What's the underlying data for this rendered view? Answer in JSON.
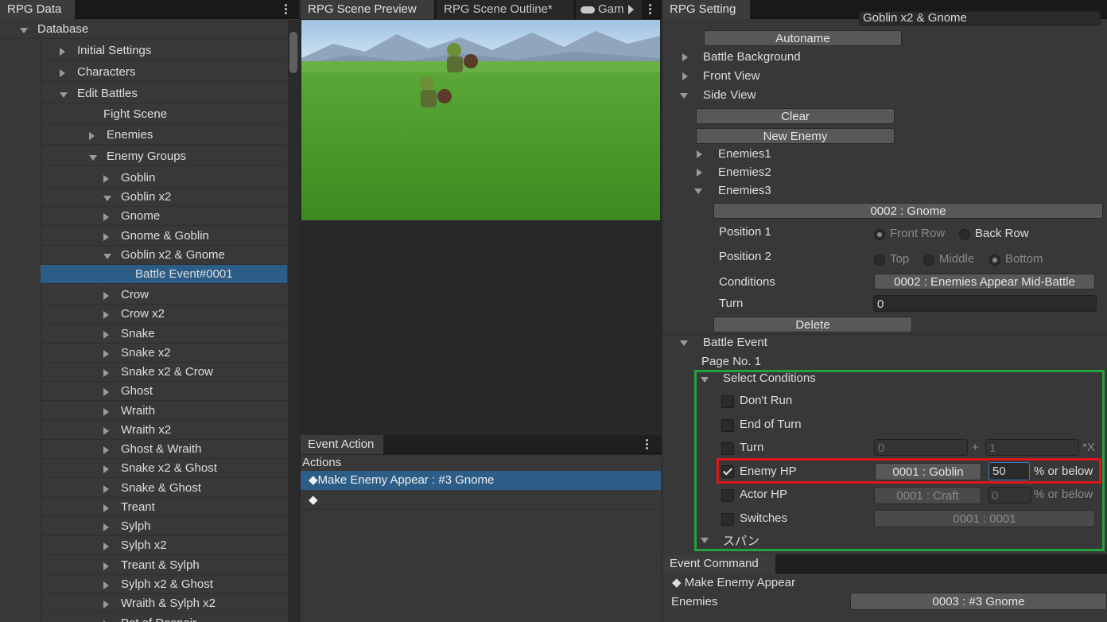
{
  "left_panel": {
    "tab": "RPG Data",
    "tree": [
      {
        "label": "Database",
        "expanded": true
      },
      {
        "label": "Initial Settings",
        "expanded": false
      },
      {
        "label": "Characters",
        "expanded": false
      },
      {
        "label": "Edit Battles",
        "expanded": true
      },
      {
        "label": "Fight Scene"
      },
      {
        "label": "Enemies",
        "expanded": false
      },
      {
        "label": "Enemy Groups",
        "expanded": true
      },
      {
        "label": "Goblin",
        "expanded": false
      },
      {
        "label": "Goblin x2",
        "expanded": true
      },
      {
        "label": "Gnome",
        "expanded": false
      },
      {
        "label": "Gnome & Goblin",
        "expanded": false
      },
      {
        "label": "Goblin x2 & Gnome",
        "expanded": true
      },
      {
        "label": "Battle Event#0001",
        "selected": true
      },
      {
        "label": "Crow",
        "expanded": false
      },
      {
        "label": "Crow x2",
        "expanded": false
      },
      {
        "label": "Snake",
        "expanded": false
      },
      {
        "label": "Snake x2",
        "expanded": false
      },
      {
        "label": "Snake x2 & Crow",
        "expanded": false
      },
      {
        "label": "Ghost",
        "expanded": false
      },
      {
        "label": "Wraith",
        "expanded": false
      },
      {
        "label": "Wraith x2",
        "expanded": false
      },
      {
        "label": "Ghost & Wraith",
        "expanded": false
      },
      {
        "label": "Snake x2 & Ghost",
        "expanded": false
      },
      {
        "label": "Snake & Ghost",
        "expanded": false
      },
      {
        "label": "Treant",
        "expanded": false
      },
      {
        "label": "Sylph",
        "expanded": false
      },
      {
        "label": "Sylph x2",
        "expanded": false
      },
      {
        "label": "Treant & Sylph",
        "expanded": false
      },
      {
        "label": "Sylph x2 & Ghost",
        "expanded": false
      },
      {
        "label": "Wraith & Sylph x2",
        "expanded": false
      },
      {
        "label": "Pot of Despair",
        "expanded": false
      }
    ]
  },
  "center_panel": {
    "tabs": [
      "RPG Scene Preview",
      "RPG Scene Outline*",
      "Gam"
    ],
    "event_action": {
      "tab": "Event Action",
      "actions_label": "Actions",
      "items": [
        "◆Make Enemy Appear : #3 Gnome",
        "◆"
      ]
    }
  },
  "right_panel": {
    "tab": "RPG Setting",
    "name_value": "Goblin x2 & Gnome",
    "autoname": "Autoname",
    "battle_background": "Battle Background",
    "front_view": "Front View",
    "side_view": "Side View",
    "clear": "Clear",
    "new_enemy": "New Enemy",
    "enemies1": "Enemies1",
    "enemies2": "Enemies2",
    "enemies3": "Enemies3",
    "enemy3_value": "0002 : Gnome",
    "position1_label": "Position 1",
    "front_row": "Front Row",
    "back_row": "Back Row",
    "position2_label": "Position 2",
    "top": "Top",
    "middle": "Middle",
    "bottom": "Bottom",
    "conditions_label": "Conditions",
    "conditions_value": "0002 : Enemies Appear Mid-Battle",
    "turn_label": "Turn",
    "turn_value": "0",
    "delete": "Delete",
    "battle_event": "Battle Event",
    "page_no": "Page No. 1",
    "select_conditions": "Select Conditions",
    "dont_run": "Don't Run",
    "end_of_turn": "End of Turn",
    "turn_cond": "Turn",
    "turn_a": "0",
    "plus": "+",
    "turn_b": "1",
    "times_x": "*X",
    "enemy_hp": "Enemy HP",
    "enemy_hp_target": "0001 : Goblin",
    "enemy_hp_value": "50",
    "pct_below": "% or below",
    "actor_hp": "Actor HP",
    "actor_hp_target": "0001 : Craft",
    "actor_hp_value": "0",
    "pct_below2": "% or below",
    "switches": "Switches",
    "switches_value": "0001 : 0001",
    "span": "スパン",
    "event_command": {
      "tab": "Event Command",
      "title": "◆ Make Enemy Appear",
      "enemies_label": "Enemies",
      "enemies_value": "0003 : #3 Gnome"
    }
  },
  "colors": {
    "selection": "#2c5d87",
    "highlight_green": "#22a33a",
    "highlight_red": "#e0151b"
  }
}
